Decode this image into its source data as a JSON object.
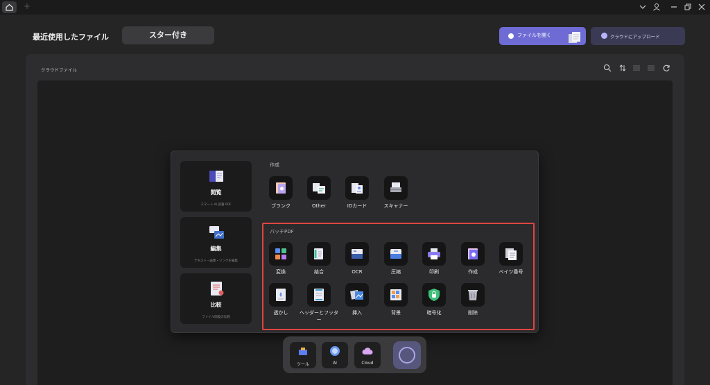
{
  "header": {
    "recent_files": "最近使用したファイル",
    "starred_tab": "スター付き",
    "open_file": "ファイルを開く",
    "upload_cloud": "クラウドにアップロード"
  },
  "panel": {
    "cloud_files": "クラウドファイル"
  },
  "popup": {
    "left_cards": [
      {
        "title": "閲覧",
        "subtitle": "スマート AI 読書 PDF"
      },
      {
        "title": "編集",
        "subtitle": "テキスト・画像・リンクを編集"
      },
      {
        "title": "比較",
        "subtitle": "ファイル間差の比較"
      }
    ],
    "create_section": {
      "title": "作成",
      "items": [
        "ブランク",
        "Other",
        "IDカード",
        "スキャナー"
      ]
    },
    "batch_section": {
      "title": "バッチPDF",
      "items": [
        "変換",
        "結合",
        "OCR",
        "圧縮",
        "印刷",
        "作成",
        "ベイツ番号",
        "透かし",
        "ヘッダーとフッター",
        "挿入",
        "背景",
        "暗号化",
        "削除"
      ]
    }
  },
  "dock": {
    "items": [
      "ツール",
      "AI",
      "Cloud"
    ]
  },
  "colors": {
    "accent": "#6e6cd4",
    "highlight": "#e0443f"
  }
}
